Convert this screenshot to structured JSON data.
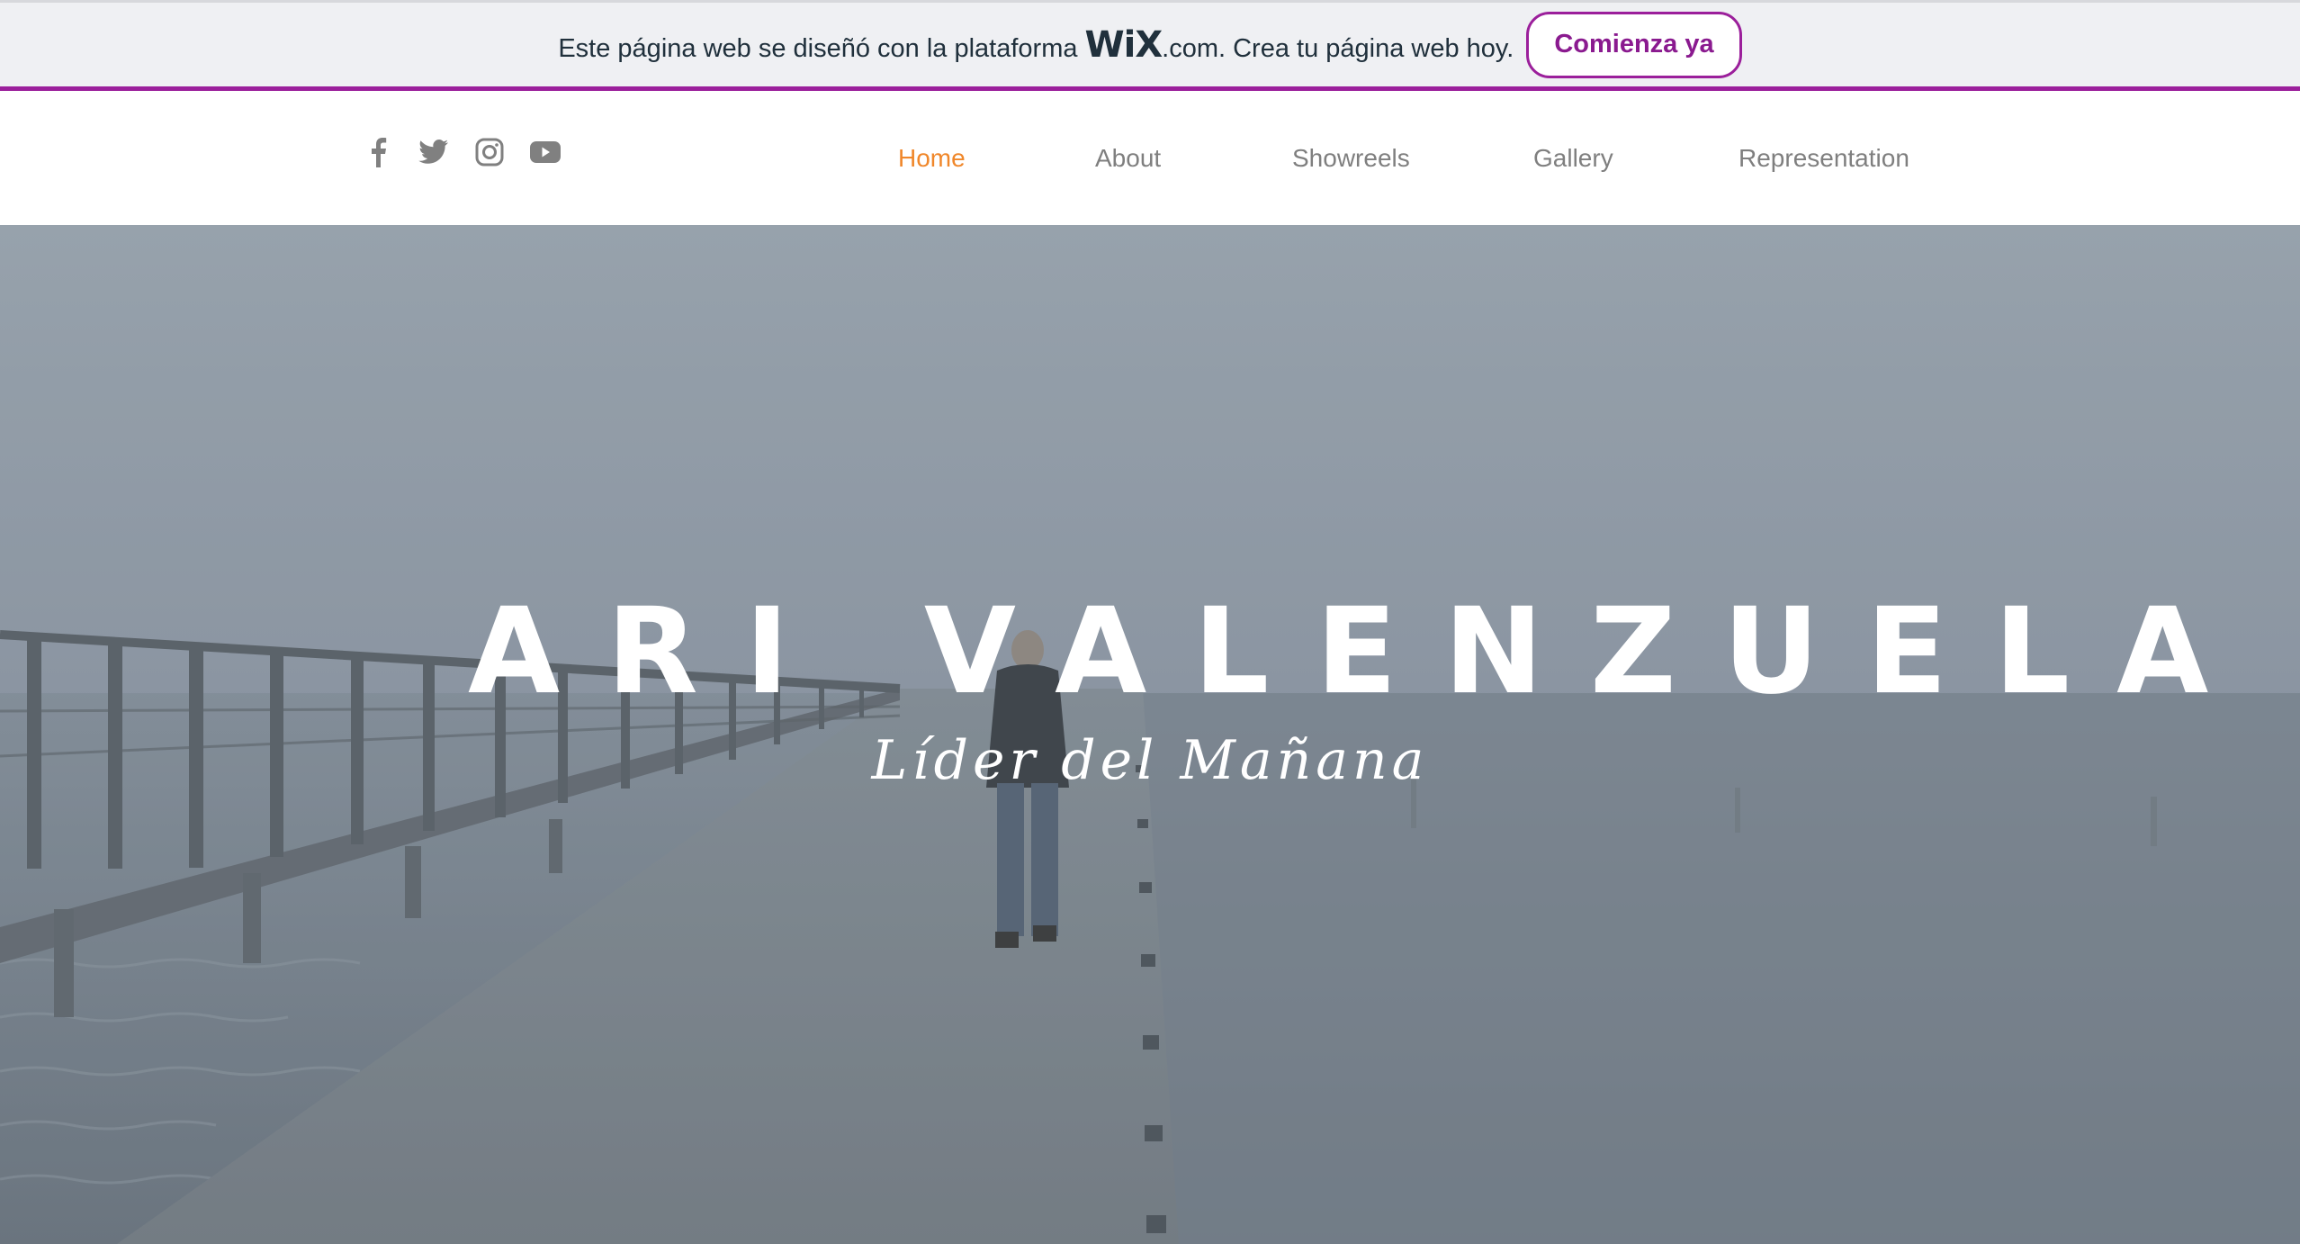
{
  "banner": {
    "text_before": "Este página web se diseñó con la plataforma",
    "logo": "WiX",
    "text_after": ".com. Crea tu página web hoy.",
    "cta_label": "Comienza ya",
    "accent_color": "#9b1f9b"
  },
  "social": [
    {
      "icon": "facebook-icon"
    },
    {
      "icon": "twitter-icon"
    },
    {
      "icon": "instagram-icon"
    },
    {
      "icon": "youtube-icon"
    }
  ],
  "nav": {
    "items": [
      {
        "label": "Home",
        "active": true
      },
      {
        "label": "About",
        "active": false
      },
      {
        "label": "Showreels",
        "active": false
      },
      {
        "label": "Gallery",
        "active": false
      },
      {
        "label": "Representation",
        "active": false
      }
    ],
    "active_color": "#f0872a",
    "color": "#7f7f7f"
  },
  "hero": {
    "title": "ARI VALENZUELA",
    "subtitle": "Líder del Mañana"
  }
}
